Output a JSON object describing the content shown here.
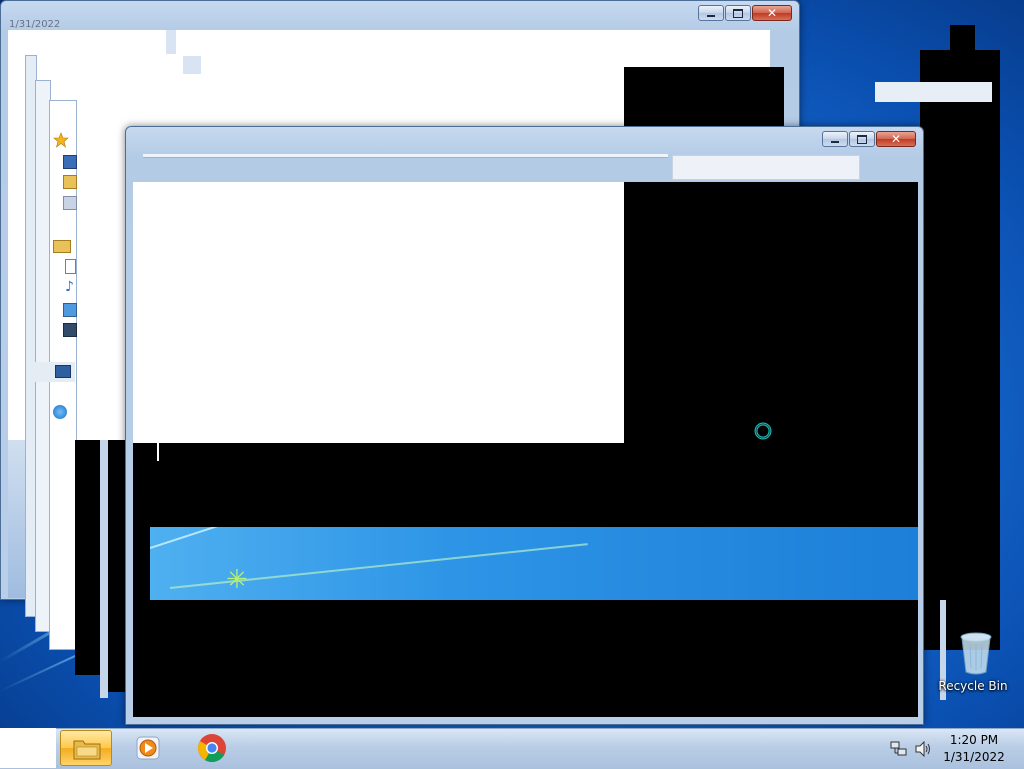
{
  "screen": {
    "width": 1024,
    "height": 768
  },
  "colors": {
    "desktop_blue": "#1a6fd6",
    "window_frame": "#b9cfe9",
    "close_red": "#c23a22",
    "taskbar": "#b9cde6",
    "busy_ring": "#1fb8b0"
  },
  "back_window": {
    "title_fragment": "1/31/2022",
    "buttons": [
      "minimize",
      "maximize",
      "close"
    ]
  },
  "front_window": {
    "buttons": [
      "minimize",
      "maximize",
      "close"
    ]
  },
  "sidebar_icons": [
    "star-icon",
    "desktop-icon",
    "folder-icon",
    "network-places-icon",
    "libraries-icon",
    "documents-icon",
    "music-icon",
    "pictures-icon",
    "videos-icon",
    "computer-icon",
    "network-icon"
  ],
  "desktop": {
    "recycle_bin_label": "Recycle Bin"
  },
  "taskbar": {
    "pinned": [
      {
        "name": "windows-explorer",
        "icon": "folder-icon",
        "active": true
      },
      {
        "name": "media-player",
        "icon": "media-player-icon",
        "active": false
      },
      {
        "name": "chrome",
        "icon": "chrome-icon",
        "active": false
      }
    ],
    "clock_time": "1:20 PM",
    "clock_date": "1/31/2022"
  }
}
